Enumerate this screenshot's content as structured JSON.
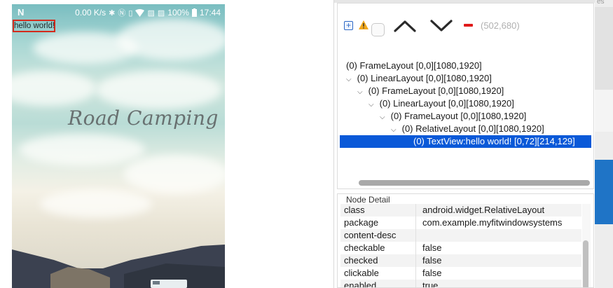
{
  "status_bar": {
    "carrier_icon": "N",
    "speed": "0.00 K/s",
    "battery": "100%",
    "time": "17:44",
    "icons": [
      "bluetooth-icon",
      "nfc-icon",
      "vibrate-icon",
      "wifi-icon",
      "no-sim-icon",
      "no-sim-icon"
    ]
  },
  "app": {
    "hello_text": "hello world!",
    "title": "Road Camping"
  },
  "toolbar": {
    "coords": "(502,680)"
  },
  "tree": [
    {
      "label": "(0) FrameLayout [0,0][1080,1920]",
      "chevron": ""
    },
    {
      "label": "(0) LinearLayout [0,0][1080,1920]",
      "chevron": "v"
    },
    {
      "label": "(0) FrameLayout [0,0][1080,1920]",
      "chevron": "v"
    },
    {
      "label": "(0) LinearLayout [0,0][1080,1920]",
      "chevron": "v"
    },
    {
      "label": "(0) FrameLayout [0,0][1080,1920]",
      "chevron": "v"
    },
    {
      "label": "(0) RelativeLayout [0,0][1080,1920]",
      "chevron": "v"
    },
    {
      "label": "(0) TextView:hello world! [0,72][214,129]",
      "chevron": ""
    }
  ],
  "node_detail": {
    "title": "Node Detail",
    "rows": [
      {
        "key": "class",
        "value": "android.widget.RelativeLayout"
      },
      {
        "key": "package",
        "value": "com.example.myfitwindowsystems"
      },
      {
        "key": "content-desc",
        "value": ""
      },
      {
        "key": "checkable",
        "value": "false"
      },
      {
        "key": "checked",
        "value": "false"
      },
      {
        "key": "clickable",
        "value": "false"
      },
      {
        "key": "enabled",
        "value": "true"
      }
    ]
  },
  "right_strip": {
    "text": "es"
  },
  "colors": {
    "selection": "#0a59d8",
    "highlight_border": "#d42a1c",
    "remove_button": "#e01a1a"
  }
}
